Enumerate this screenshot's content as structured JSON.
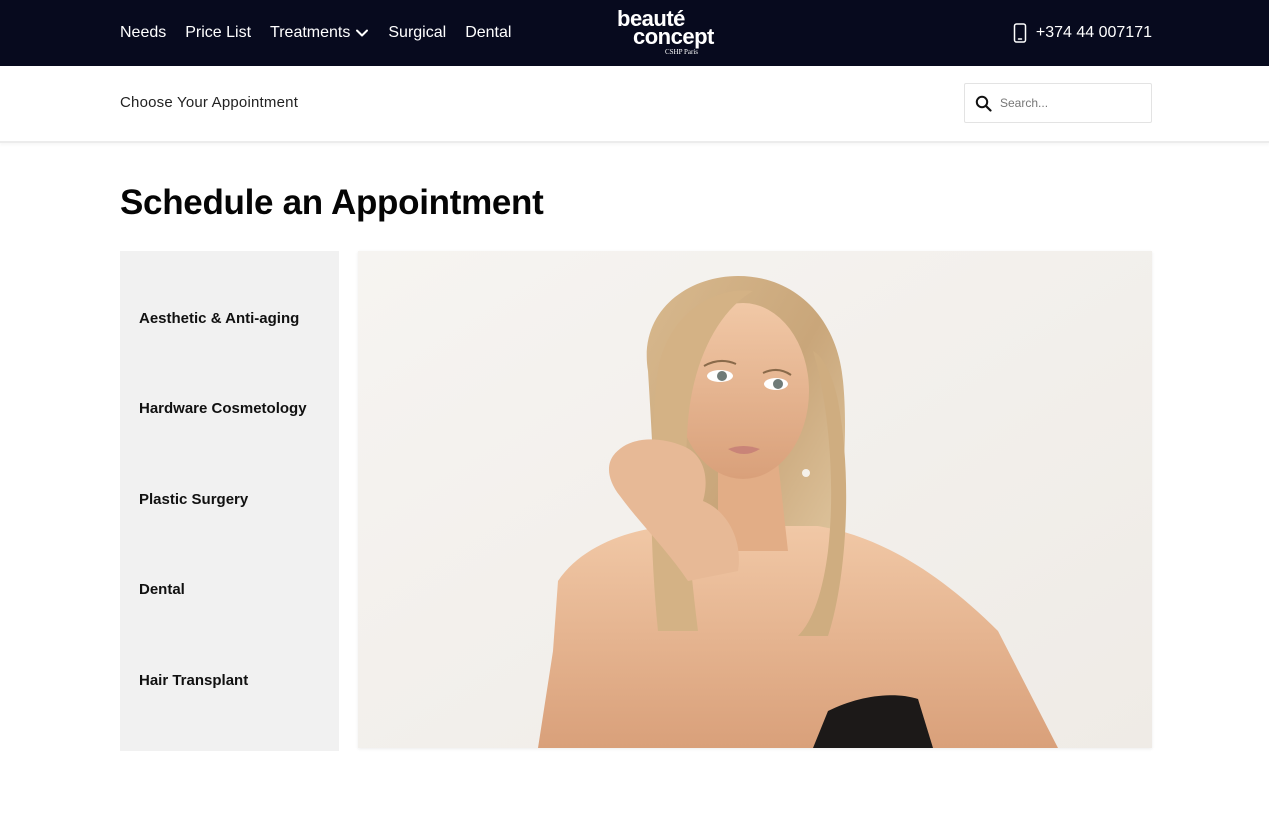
{
  "header": {
    "nav": [
      {
        "label": "Needs"
      },
      {
        "label": "Price List"
      },
      {
        "label": "Treatments"
      },
      {
        "label": "Surgical"
      },
      {
        "label": "Dental"
      }
    ],
    "logo": {
      "line1": "beauté",
      "line2": "concept",
      "line3": "CSHP Paris"
    },
    "phone": "+374 44 007171"
  },
  "subheader": {
    "title": "Choose Your Appointment",
    "search_placeholder": "Search..."
  },
  "main": {
    "heading": "Schedule an Appointment",
    "categories": [
      {
        "label": "Aesthetic & Anti-aging"
      },
      {
        "label": "Hardware Cosmetology"
      },
      {
        "label": "Plastic Surgery"
      },
      {
        "label": "Dental"
      },
      {
        "label": "Hair Transplant"
      }
    ]
  },
  "colors": {
    "topbar": "#070a1e",
    "panel": "#f1f1f1",
    "text": "#0a0a0a"
  }
}
